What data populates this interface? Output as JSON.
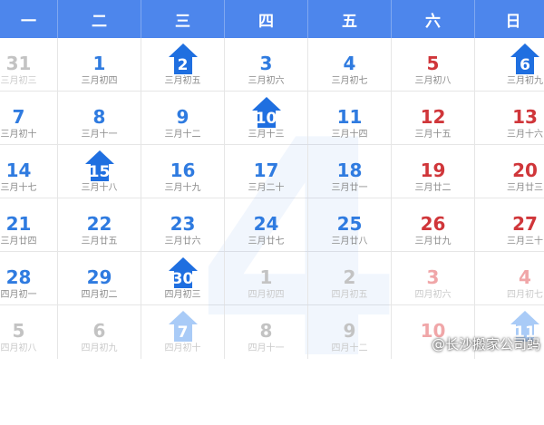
{
  "weekdays": [
    "一",
    "二",
    "三",
    "四",
    "五",
    "六",
    "日"
  ],
  "weeks": [
    [
      {
        "day": "31",
        "lunar": "三月初三",
        "color": "gray",
        "lunar_faded": true
      },
      {
        "day": "1",
        "lunar": "三月初四",
        "color": "blue"
      },
      {
        "day": "2",
        "lunar": "三月初五",
        "color": "blue",
        "holiday_marker": true
      },
      {
        "day": "3",
        "lunar": "三月初六",
        "color": "blue"
      },
      {
        "day": "4",
        "lunar": "三月初七",
        "color": "blue"
      },
      {
        "day": "5",
        "lunar": "三月初八",
        "color": "red"
      },
      {
        "day": "6",
        "lunar": "三月初九",
        "color": "blue",
        "holiday_marker": true
      }
    ],
    [
      {
        "day": "7",
        "lunar": "三月初十",
        "color": "blue"
      },
      {
        "day": "8",
        "lunar": "三月十一",
        "color": "blue"
      },
      {
        "day": "9",
        "lunar": "三月十二",
        "color": "blue"
      },
      {
        "day": "10",
        "lunar": "三月十三",
        "color": "blue",
        "holiday_marker": true
      },
      {
        "day": "11",
        "lunar": "三月十四",
        "color": "blue"
      },
      {
        "day": "12",
        "lunar": "三月十五",
        "color": "red"
      },
      {
        "day": "13",
        "lunar": "三月十六",
        "color": "red"
      }
    ],
    [
      {
        "day": "14",
        "lunar": "三月十七",
        "color": "blue"
      },
      {
        "day": "15",
        "lunar": "三月十八",
        "color": "blue",
        "holiday_marker": true
      },
      {
        "day": "16",
        "lunar": "三月十九",
        "color": "blue"
      },
      {
        "day": "17",
        "lunar": "三月二十",
        "color": "blue"
      },
      {
        "day": "18",
        "lunar": "三月廿一",
        "color": "blue"
      },
      {
        "day": "19",
        "lunar": "三月廿二",
        "color": "red"
      },
      {
        "day": "20",
        "lunar": "三月廿三",
        "color": "red"
      }
    ],
    [
      {
        "day": "21",
        "lunar": "三月廿四",
        "color": "blue"
      },
      {
        "day": "22",
        "lunar": "三月廿五",
        "color": "blue"
      },
      {
        "day": "23",
        "lunar": "三月廿六",
        "color": "blue"
      },
      {
        "day": "24",
        "lunar": "三月廿七",
        "color": "blue"
      },
      {
        "day": "25",
        "lunar": "三月廿八",
        "color": "blue"
      },
      {
        "day": "26",
        "lunar": "三月廿九",
        "color": "red"
      },
      {
        "day": "27",
        "lunar": "三月三十",
        "color": "red"
      }
    ],
    [
      {
        "day": "28",
        "lunar": "四月初一",
        "color": "blue"
      },
      {
        "day": "29",
        "lunar": "四月初二",
        "color": "blue"
      },
      {
        "day": "30",
        "lunar": "四月初三",
        "color": "blue",
        "holiday_marker": true
      },
      {
        "day": "1",
        "lunar": "四月初四",
        "color": "gray",
        "lunar_faded": true
      },
      {
        "day": "2",
        "lunar": "四月初五",
        "color": "gray",
        "lunar_faded": true
      },
      {
        "day": "3",
        "lunar": "四月初六",
        "color": "lightred",
        "lunar_faded": true
      },
      {
        "day": "4",
        "lunar": "四月初七",
        "color": "lightred",
        "lunar_faded": true
      }
    ],
    [
      {
        "day": "5",
        "lunar": "四月初八",
        "color": "gray",
        "lunar_faded": true
      },
      {
        "day": "6",
        "lunar": "四月初九",
        "color": "gray",
        "lunar_faded": true
      },
      {
        "day": "7",
        "lunar": "四月初十",
        "color": "blue",
        "holiday_marker": true,
        "faint": true,
        "lunar_faded": true
      },
      {
        "day": "8",
        "lunar": "四月十一",
        "color": "gray",
        "lunar_faded": true
      },
      {
        "day": "9",
        "lunar": "四月十二",
        "color": "gray",
        "lunar_faded": true
      },
      {
        "day": "10",
        "lunar": "",
        "color": "lightred",
        "lunar_faded": true
      },
      {
        "day": "11",
        "lunar": "",
        "color": "blue",
        "holiday_marker": true,
        "faint": true,
        "lunar_faded": true
      }
    ]
  ],
  "month_watermark": "4",
  "source_credit": "@长沙搬家公司蚂",
  "colors": {
    "header_bg": "#4d86ec",
    "weekday_number": "#2f7be0",
    "weekend_number": "#d0363a",
    "holiday_marker": "#1f6fe0",
    "faint_marker": "#a9cbf7"
  }
}
